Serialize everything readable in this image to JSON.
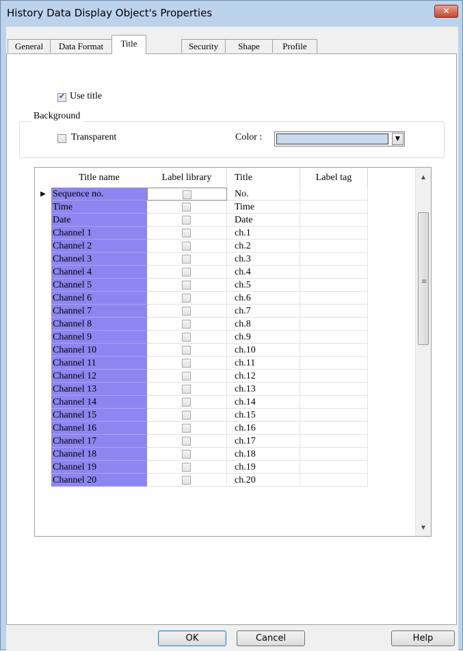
{
  "window": {
    "title": "History Data Display Object's Properties",
    "close_icon": "close-icon"
  },
  "tabs": [
    {
      "label": "General"
    },
    {
      "label": "Data Format"
    },
    {
      "label": "Title",
      "active": true
    },
    {
      "label": "Security"
    },
    {
      "label": "Shape"
    },
    {
      "label": "Profile"
    }
  ],
  "use_title": {
    "label": "Use title",
    "checked": true
  },
  "background": {
    "legend": "Background",
    "transparent": {
      "label": "Transparent",
      "checked": false
    },
    "color_label": "Color :",
    "color_value": "#c6d9ee"
  },
  "grid": {
    "headers": [
      "Title name",
      "Label library",
      "Title",
      "Label tag"
    ],
    "rows": [
      {
        "name": "Sequence no.",
        "library": false,
        "title": "No."
      },
      {
        "name": "Time",
        "library": false,
        "title": "Time"
      },
      {
        "name": "Date",
        "library": false,
        "title": "Date"
      },
      {
        "name": "Channel 1",
        "library": false,
        "title": "ch.1"
      },
      {
        "name": "Channel 2",
        "library": false,
        "title": "ch.2"
      },
      {
        "name": "Channel 3",
        "library": false,
        "title": "ch.3"
      },
      {
        "name": "Channel 4",
        "library": false,
        "title": "ch.4"
      },
      {
        "name": "Channel 5",
        "library": false,
        "title": "ch.5"
      },
      {
        "name": "Channel 6",
        "library": false,
        "title": "ch.6"
      },
      {
        "name": "Channel 7",
        "library": false,
        "title": "ch.7"
      },
      {
        "name": "Channel 8",
        "library": false,
        "title": "ch.8"
      },
      {
        "name": "Channel 9",
        "library": false,
        "title": "ch.9"
      },
      {
        "name": "Channel 10",
        "library": false,
        "title": "ch.10"
      },
      {
        "name": "Channel 11",
        "library": false,
        "title": "ch.11"
      },
      {
        "name": "Channel 12",
        "library": false,
        "title": "ch.12"
      },
      {
        "name": "Channel 13",
        "library": false,
        "title": "ch.13"
      },
      {
        "name": "Channel 14",
        "library": false,
        "title": "ch.14"
      },
      {
        "name": "Channel 15",
        "library": false,
        "title": "ch.15"
      },
      {
        "name": "Channel 16",
        "library": false,
        "title": "ch.16"
      },
      {
        "name": "Channel 17",
        "library": false,
        "title": "ch.17"
      },
      {
        "name": "Channel 18",
        "library": false,
        "title": "ch.18"
      },
      {
        "name": "Channel 19",
        "library": false,
        "title": "ch.19"
      },
      {
        "name": "Channel 20",
        "library": false,
        "title": "ch.20"
      }
    ],
    "row_indicator_icon": "row-pointer-icon",
    "name_cell_color": "#8d86f0"
  },
  "buttons": {
    "ok": "OK",
    "cancel": "Cancel",
    "help": "Help"
  }
}
